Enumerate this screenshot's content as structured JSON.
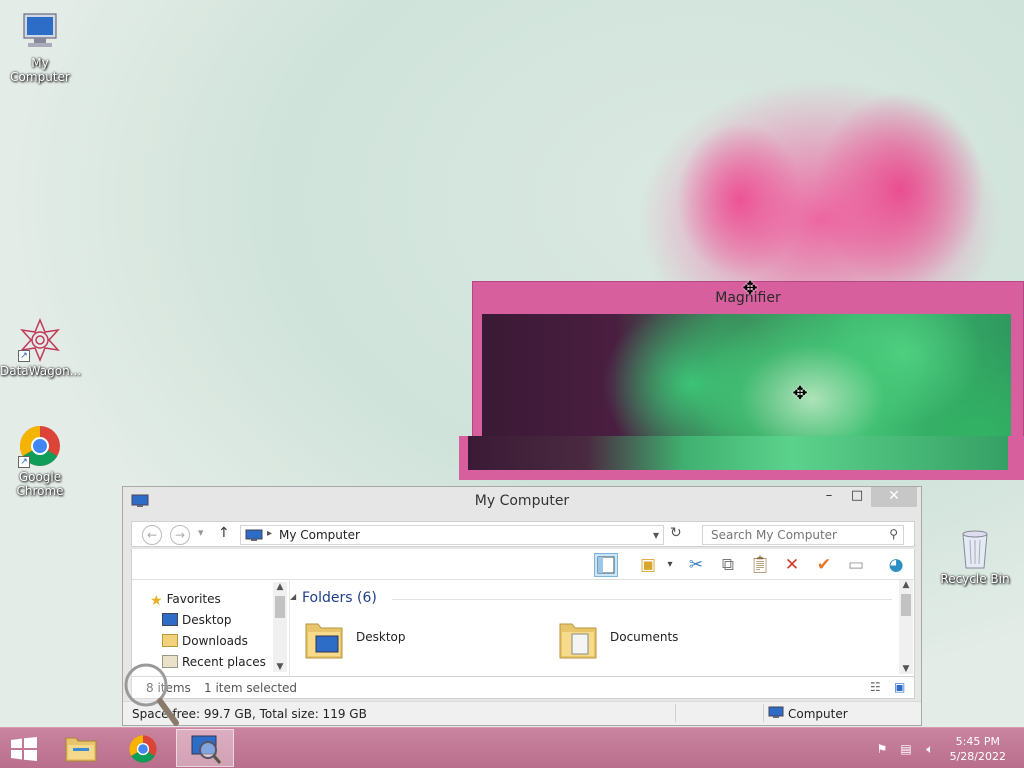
{
  "desktop": {
    "icons": [
      {
        "label": "My Computer"
      },
      {
        "label": "DataWagon..."
      },
      {
        "label": "Google Chrome"
      },
      {
        "label": "Recycle Bin"
      }
    ]
  },
  "magnifier": {
    "title": "Magnifier"
  },
  "explorer": {
    "title": "My Computer",
    "controls": {
      "minimize": "–",
      "maximize": "□",
      "close": "✕"
    },
    "address": {
      "back": "←",
      "forward": "→",
      "recent": "▾",
      "up": "↑",
      "path": "My Computer",
      "dropdown": "▾",
      "refresh": "↻"
    },
    "search": {
      "placeholder": "Search My Computer"
    },
    "toolbar": {
      "icons": [
        "view-pane-icon",
        "properties-icon",
        "cut-icon",
        "copy-icon",
        "paste-icon",
        "delete-icon",
        "select-icon",
        "rename-icon",
        "network-icon"
      ]
    },
    "nav_pane": {
      "items": [
        {
          "label": "Favorites",
          "icon": "star-icon"
        },
        {
          "label": "Desktop",
          "icon": "desktop-icon"
        },
        {
          "label": "Downloads",
          "icon": "downloads-icon"
        },
        {
          "label": "Recent places",
          "icon": "recent-places-icon"
        }
      ]
    },
    "main_pane": {
      "group_toggle": "◢",
      "group_header": "Folders (6)",
      "folders": [
        {
          "label": "Desktop"
        },
        {
          "label": "Documents"
        }
      ]
    },
    "status": {
      "items_count": "8 items",
      "selected": "1 item selected",
      "space": "Space free: 99.7 GB, Total size: 119 GB",
      "location": "Computer"
    }
  },
  "taskbar": {
    "start_icon": "windows-logo-icon",
    "tasks": [
      {
        "name": "file-explorer-icon"
      },
      {
        "name": "chrome-icon"
      },
      {
        "name": "magnifier-icon"
      }
    ],
    "clock": {
      "time": "5:45 PM",
      "date": "5/28/2022"
    }
  },
  "colors": {
    "taskbar": "#b96f8c",
    "magnifier_frame": "#d85f9e",
    "folder_header": "#1e3f8a"
  }
}
